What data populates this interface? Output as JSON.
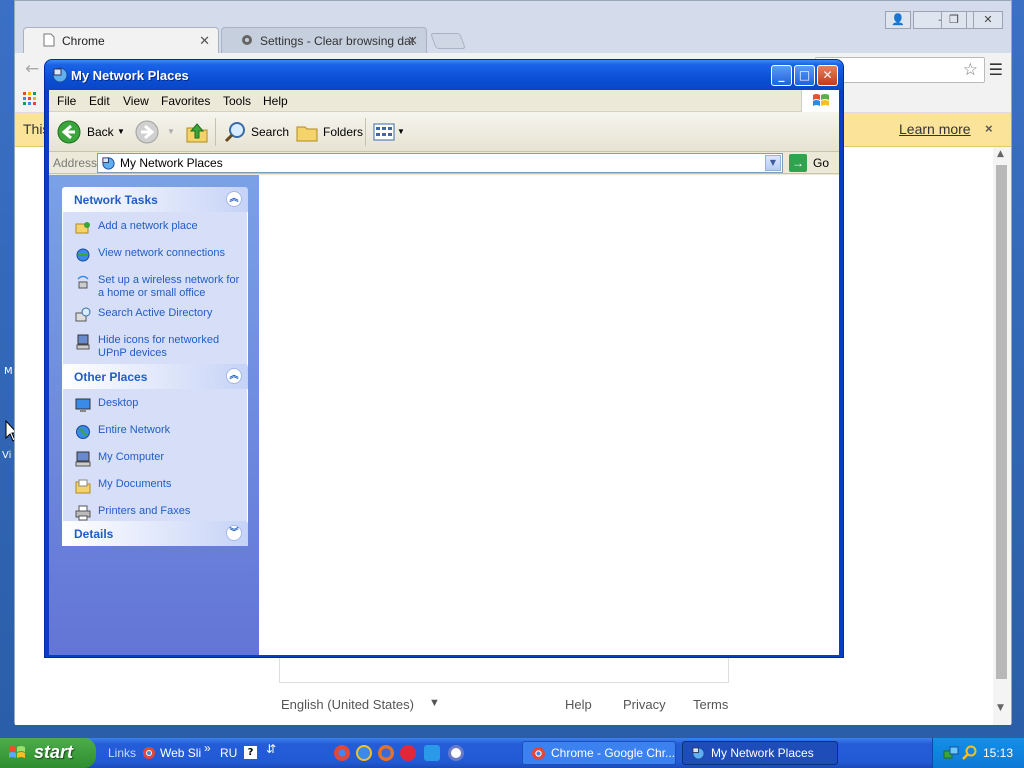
{
  "chrome": {
    "tabs": [
      {
        "label": "Chrome"
      },
      {
        "label": "Settings - Clear browsing dat"
      }
    ],
    "infobar": {
      "text": "This",
      "learn_more": "Learn more",
      "close": "×"
    },
    "footer": {
      "language": "English (United States)",
      "help": "Help",
      "privacy": "Privacy",
      "terms": "Terms"
    }
  },
  "explorer": {
    "title": "My Network Places",
    "menu": [
      "File",
      "Edit",
      "View",
      "Favorites",
      "Tools",
      "Help"
    ],
    "toolbar": {
      "back": "Back",
      "search": "Search",
      "folders": "Folders"
    },
    "address": {
      "label": "Address",
      "value": "My Network Places",
      "go": "Go"
    },
    "network_tasks": {
      "title": "Network Tasks",
      "items": [
        "Add a network place",
        "View network connections",
        "Set up a wireless network for a home or small office",
        "Search Active Directory",
        "Hide icons for networked UPnP devices"
      ]
    },
    "other_places": {
      "title": "Other Places",
      "items": [
        "Desktop",
        "Entire Network",
        "My Computer",
        "My Documents",
        "Printers and Faxes"
      ]
    },
    "details": {
      "title": "Details"
    }
  },
  "taskbar": {
    "start": "start",
    "links": "Links",
    "web_slice": "Web Sli",
    "chevron": "»",
    "lang": "RU",
    "tasks": [
      {
        "label": "Chrome - Google Chr..."
      },
      {
        "label": "My Network Places"
      }
    ],
    "clock": "15:13"
  },
  "desktop": {
    "stub1": "M",
    "stub2": "Vi"
  },
  "colors": {
    "xp_blue": "#0a46c4",
    "task_link": "#215dc6",
    "start_green": "#3a9a3a",
    "infobar": "#fbe49a"
  }
}
